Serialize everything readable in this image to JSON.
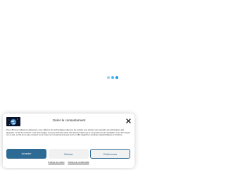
{
  "loader": {
    "dot_colors": [
      "#9bd3f2",
      "#4cb6ec",
      "#1e9be0"
    ]
  },
  "consent": {
    "logo_icon": "brand-logo",
    "title": "Gérer le consentement",
    "close_icon": "close-icon",
    "message": "Pour offrir les meilleures expériences, nous utilisons des technologies telles que les cookies pour stocker et/ou accéder aux informations des appareils. Le fait de consentir à ces technologies nous permettra de traiter des données telles que le comportement de navigation ou les ID uniques sur ce site. Le fait de ne pas consentir ou de retirer son consentement peut avoir un effet négatif sur certaines caractéristiques et fonctions.",
    "accept_label": "Accepter",
    "deny_label": "Refuser",
    "preferences_label": "Préférences",
    "cookie_policy_label": "Politique de cookies",
    "privacy_policy_label": "Politique de confidentialité",
    "accent_color": "#2d6a94"
  }
}
